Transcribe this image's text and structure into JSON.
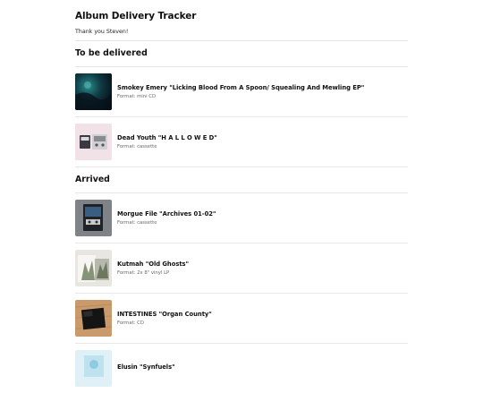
{
  "app": {
    "title": "Album Delivery Tracker",
    "thanks": "Thank you Steven!"
  },
  "sections": [
    {
      "title": "To be delivered",
      "items": [
        {
          "title": "Smokey Emery \"Licking Blood From A Spoon/ Squealing And Mewling EP\"",
          "format": "Format: mini CD",
          "cover": "dark-teal-cover"
        },
        {
          "title": "Dead Youth \"H A L L O W E D\"",
          "format": "Format: cassette",
          "cover": "cassette-pink-cover"
        }
      ]
    },
    {
      "title": "Arrived",
      "items": [
        {
          "title": "Morgue File \"Archives 01-02\"",
          "format": "Format: cassette",
          "cover": "cassette-grey-cover"
        },
        {
          "title": "Kutmah \"Old Ghosts\"",
          "format": "Format: 2x 8\" vinyl LP",
          "cover": "vinyl-photo-cover"
        },
        {
          "title": "INTESTINES \"Organ County\"",
          "format": "Format: CD",
          "cover": "cd-wood-cover"
        },
        {
          "title": "Elusin \"Synfuels\"",
          "format": "",
          "cover": "light-blue-cover"
        }
      ]
    }
  ]
}
